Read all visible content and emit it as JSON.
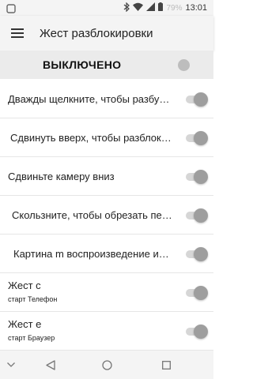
{
  "status_bar": {
    "battery_percent": "79%",
    "time": "13:01",
    "icons": [
      "notification-icon",
      "bluetooth-icon",
      "wifi-icon",
      "signal-icon",
      "battery-icon"
    ]
  },
  "header": {
    "title": "Жест разблокировки",
    "menu_icon": "hamburger-menu-icon"
  },
  "master_switch": {
    "label": "ВЫКЛЮЧЕНО",
    "state": "off"
  },
  "settings": [
    {
      "label": "Дважды щелкните, чтобы разбу…",
      "state": "on"
    },
    {
      "label": "Сдвинуть вверх, чтобы разблок…",
      "state": "on"
    },
    {
      "label": "Сдвиньте камеру вниз",
      "state": "on"
    },
    {
      "label": "Скользните, чтобы обрезать пе…",
      "state": "on"
    },
    {
      "label": "Картина m воспроизведение и…",
      "state": "on"
    },
    {
      "title": "Жест c",
      "subtitle": "старт Телефон",
      "state": "on"
    },
    {
      "title": "Жест e",
      "subtitle": "старт Браузер",
      "state": "on"
    }
  ],
  "nav_bar": {
    "icons": [
      "chevron-down-icon",
      "back-icon",
      "home-icon",
      "recents-icon"
    ]
  },
  "colors": {
    "background": "#ffffff",
    "bar": "#f4f4f4",
    "master_row": "#ebebeb",
    "toggle_knob": "#9e9e9e",
    "toggle_track": "#d6d6d6"
  }
}
